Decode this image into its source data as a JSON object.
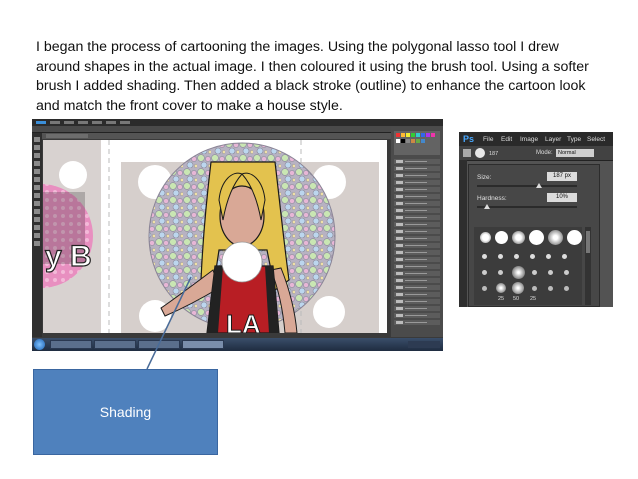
{
  "caption": "I began the process of cartooning the images. Using the polygonal lasso tool I drew around shapes in the actual image. I then coloured it using the brush tool. Using a softer brush I added shading. Then added a black stroke (outline) to enhance the cartoon look and match the front cover to make a house style.",
  "brush_panel": {
    "logo": "Ps",
    "menu": [
      "File",
      "Edit",
      "Image",
      "Layer",
      "Type",
      "Select"
    ],
    "brush_size_chip": "187",
    "mode_label": "Mode:",
    "mode_value": "Normal",
    "size_label": "Size:",
    "size_value": "187 px",
    "hardness_label": "Hardness:",
    "hardness_value": "10%",
    "size_level": 0.62,
    "hardness_level": 0.1,
    "preset_numbers": [
      "25",
      "50",
      "25"
    ]
  },
  "artwork": {
    "shirt_letters": "LA",
    "cover_fragment": "y B"
  },
  "callout": {
    "label": "Shading"
  },
  "colors": {
    "callout_fill": "#4f81bd",
    "ps_dark": "#3a3a3a",
    "hair": "#e3c24e",
    "skin": "#d9a896",
    "shirt_red": "#b81e24"
  },
  "icons": [
    "start-orb-icon",
    "brush-tool-icon",
    "photoshop-logo-icon"
  ]
}
